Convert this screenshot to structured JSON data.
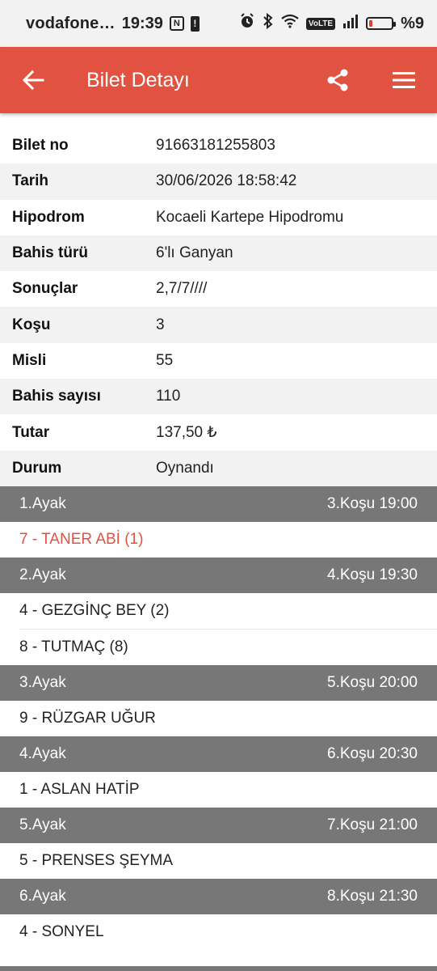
{
  "status_bar": {
    "carrier": "vodafone…",
    "time": "19:39",
    "nfc_icon": "N",
    "alert_icon": "!",
    "volte": "VoLTE",
    "battery_level_percent": 9,
    "battery_text": "%9"
  },
  "app_bar": {
    "title": "Bilet Detayı",
    "back_icon": "arrow-left-icon",
    "share_icon": "share-icon",
    "menu_icon": "menu-icon",
    "color": "#e15240"
  },
  "ticket": [
    {
      "label": "Bilet no",
      "value": "91663181255803"
    },
    {
      "label": "Tarih",
      "value": "30/06/2026 18:58:42"
    },
    {
      "label": "Hipodrom",
      "value": "Kocaeli Kartepe Hipodromu"
    },
    {
      "label": "Bahis türü",
      "value": "6'lı Ganyan"
    },
    {
      "label": "Sonuçlar",
      "value": "2,7/7////"
    },
    {
      "label": "Koşu",
      "value": "3"
    },
    {
      "label": "Misli",
      "value": "55"
    },
    {
      "label": "Bahis sayısı",
      "value": "110"
    },
    {
      "label": "Tutar",
      "value": "137,50 ₺"
    },
    {
      "label": "Durum",
      "value": "Oynandı"
    }
  ],
  "legs": [
    {
      "ayak": "1.Ayak",
      "kosu": "3.Koşu 19:00",
      "horses": [
        "7 - TANER ABİ (1)"
      ]
    },
    {
      "ayak": "2.Ayak",
      "kosu": "4.Koşu 19:30",
      "horses": [
        "4 - GEZGİNÇ BEY (2)",
        "8 - TUTMAÇ (8)"
      ]
    },
    {
      "ayak": "3.Ayak",
      "kosu": "5.Koşu 20:00",
      "horses": [
        "9 - RÜZGAR UĞUR"
      ]
    },
    {
      "ayak": "4.Ayak",
      "kosu": "6.Koşu 20:30",
      "horses": [
        "1 - ASLAN HATİP"
      ]
    },
    {
      "ayak": "5.Ayak",
      "kosu": "7.Koşu 21:00",
      "horses": [
        "5 - PRENSES ŞEYMA"
      ]
    },
    {
      "ayak": "6.Ayak",
      "kosu": "8.Koşu 21:30",
      "horses": [
        "4 - SONYEL"
      ]
    }
  ],
  "colors": {
    "winner_text": "#e15240",
    "leg_header_bg": "#777777"
  }
}
